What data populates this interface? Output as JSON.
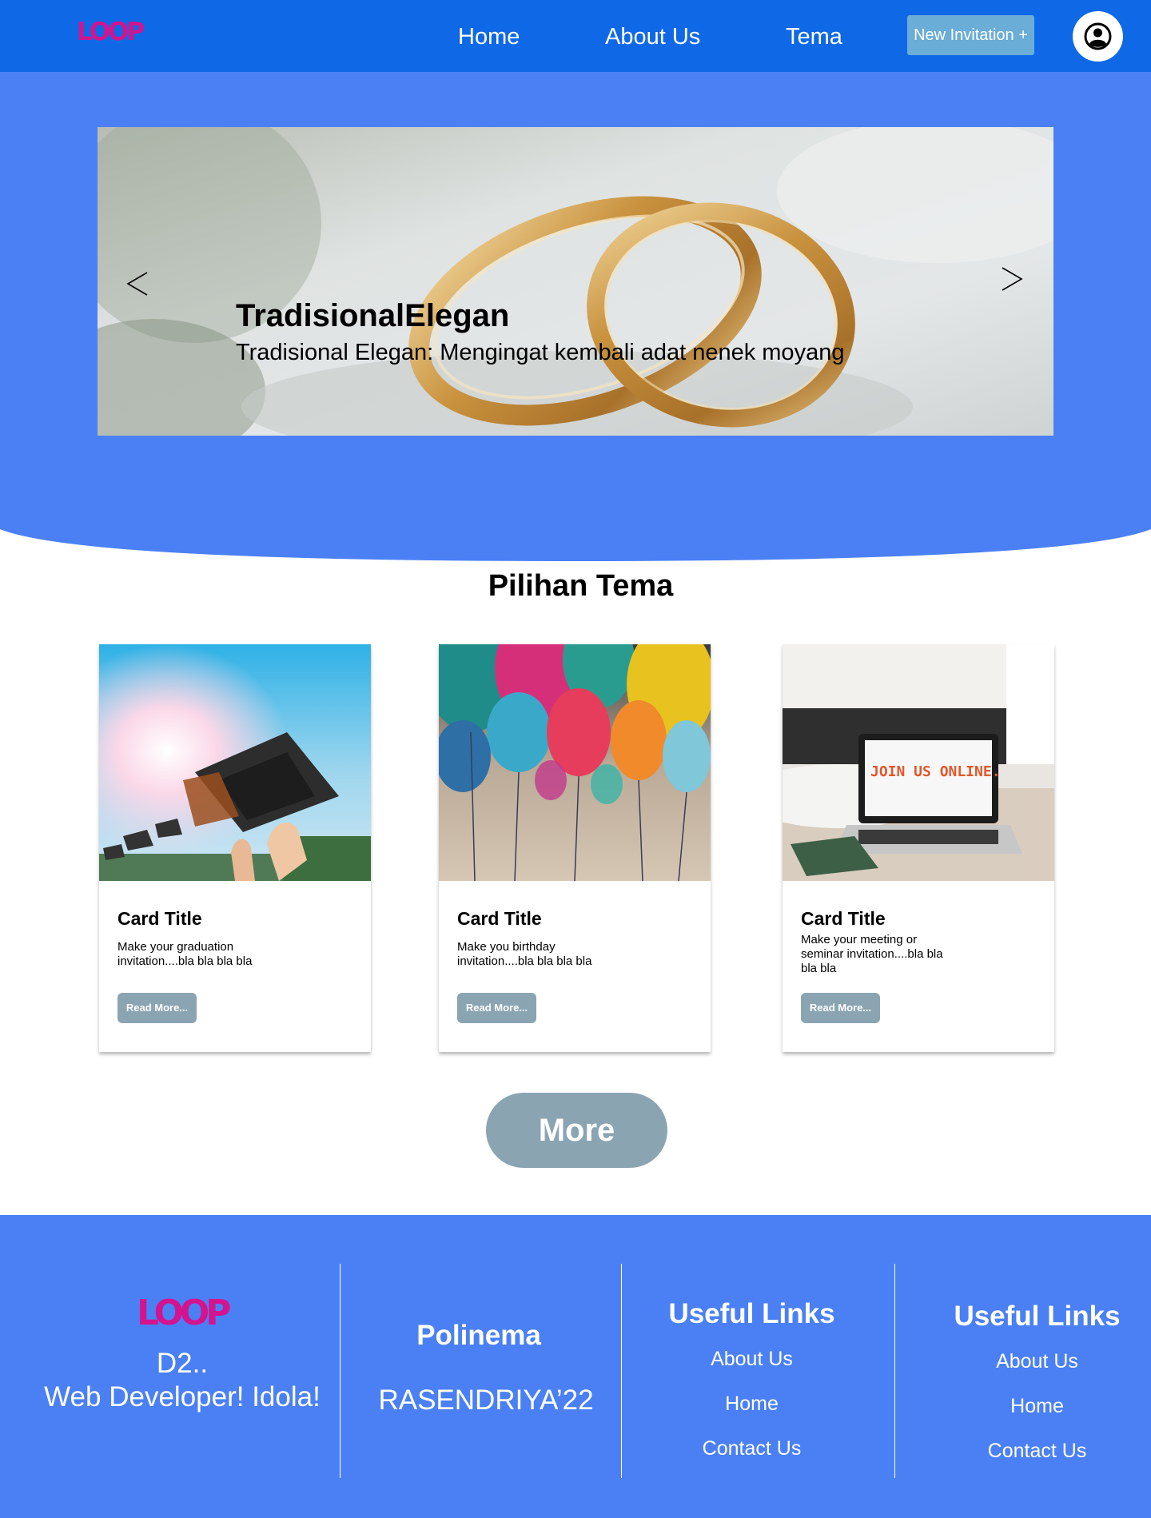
{
  "navbar": {
    "logo": "LOOP",
    "links": [
      "Home",
      "About Us",
      "Tema"
    ],
    "new_invitation": "New Invitation +",
    "avatar_icon": "user-circle-icon"
  },
  "carousel": {
    "title": "TradisionalElegan",
    "description": "Tradisional Elegan: Mengingat kembali adat nenek moyang",
    "prev_icon": "chevron-left-icon",
    "next_icon": "chevron-right-icon"
  },
  "section": {
    "title": "Pilihan Tema"
  },
  "cards": [
    {
      "title": "Card Title",
      "text": "Make your graduation invitation....bla bla bla bla",
      "button": "Read More..."
    },
    {
      "title": "Card Title",
      "text": "Make you birthday invitation....bla bla bla bla",
      "button": "Read More..."
    },
    {
      "title": "Card Title",
      "text": "Make your meeting or seminar invitation....bla bla bla bla",
      "button": "Read More...",
      "screen_text": "JOIN US ONLINE."
    }
  ],
  "more_button": "More",
  "footer": {
    "logo": "LOOP",
    "tagline_line1": "D2..",
    "tagline_line2": "Web Developer! Idola!",
    "col2_heading": "Polinema",
    "col2_text": "RASENDRIYA’22",
    "col3": {
      "heading": "Useful Links",
      "links": [
        "About Us",
        "Home",
        "Contact Us"
      ]
    },
    "col4": {
      "heading": "Useful Links",
      "links": [
        "About Us",
        "Home",
        "Contact Us"
      ]
    }
  },
  "colors": {
    "navbar": "#0f68e6",
    "hero": "#4b80f5",
    "button_gray": "#8aa4b2",
    "new_invitation": "#6aadd7",
    "logo": "#d4148f"
  }
}
